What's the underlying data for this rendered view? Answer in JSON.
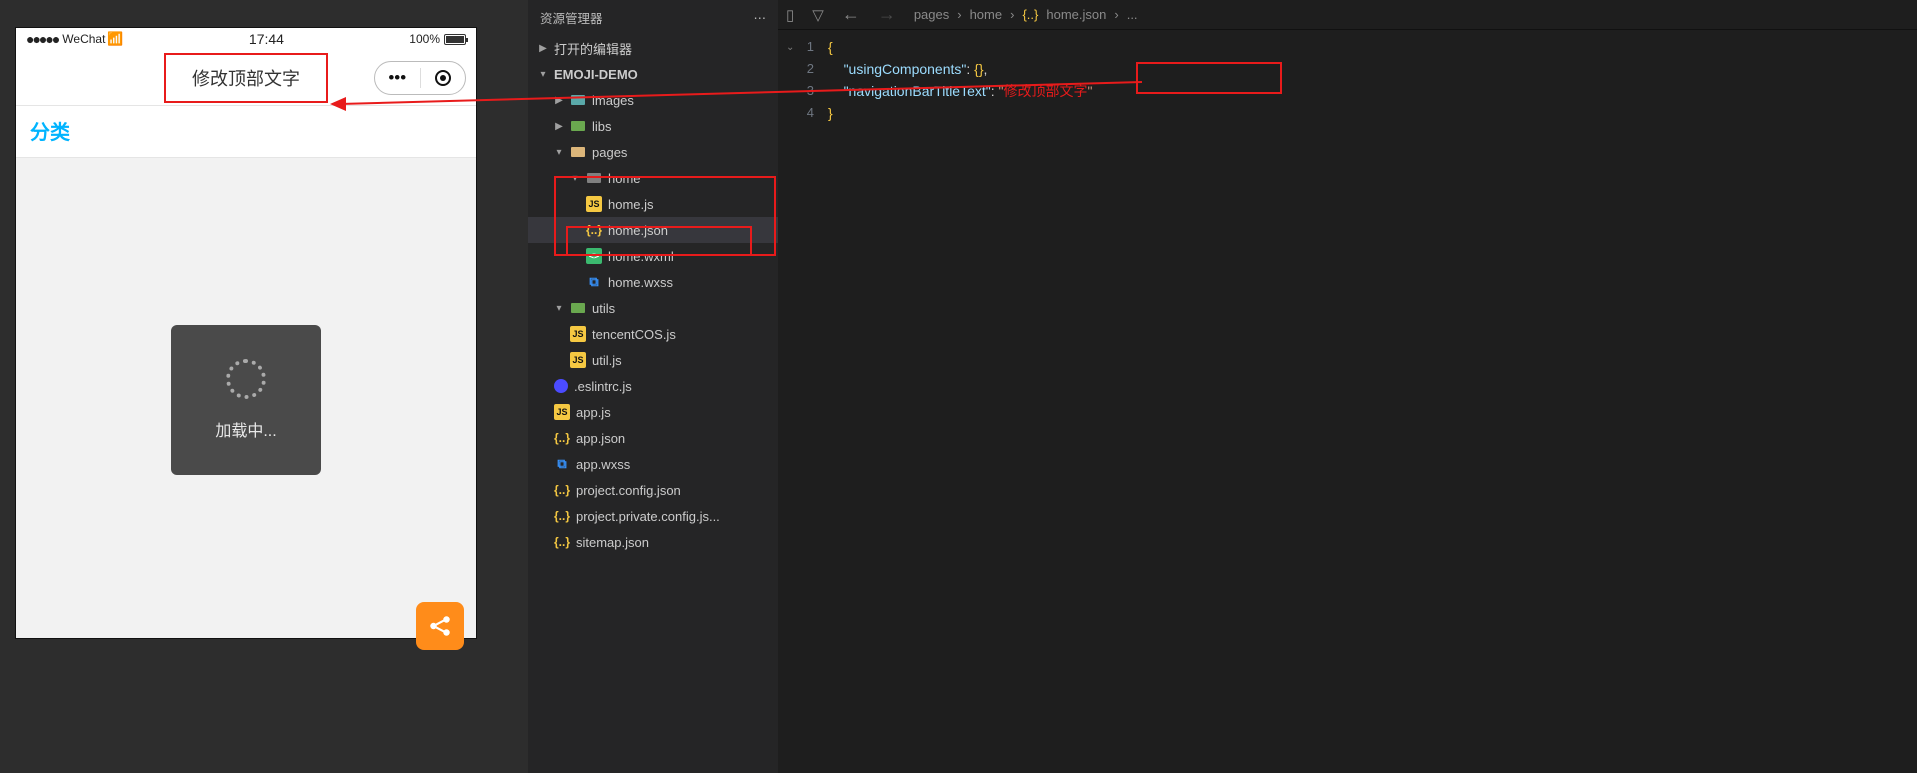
{
  "simulator": {
    "carrier": "WeChat",
    "time": "17:44",
    "battery": "100%",
    "title": "修改顶部文字",
    "tab_label": "分类",
    "loading": "加载中..."
  },
  "explorer": {
    "title": "资源管理器",
    "sections": {
      "open_editors": "打开的编辑器",
      "project": "EMOJI-DEMO"
    },
    "tree": {
      "images": "images",
      "libs": "libs",
      "pages": "pages",
      "home": "home",
      "home_js": "home.js",
      "home_json": "home.json",
      "home_wxml": "home.wxml",
      "home_wxss": "home.wxss",
      "utils": "utils",
      "tencentcos": "tencentCOS.js",
      "util": "util.js",
      "eslint": ".eslintrc.js",
      "appjs": "app.js",
      "appjson": "app.json",
      "appwxss": "app.wxss",
      "projconfig": "project.config.json",
      "projprivate": "project.private.config.js...",
      "sitemap": "sitemap.json"
    }
  },
  "editor": {
    "breadcrumb": {
      "p1": "pages",
      "p2": "home",
      "p3": "home.json",
      "more": "..."
    },
    "lines": {
      "l1": "1",
      "l2": "2",
      "l3": "3",
      "l4": "4"
    },
    "code": {
      "key1": "usingComponents",
      "val1": "{}",
      "key2": "navigationBarTitleText",
      "val2": "修改顶部文字"
    }
  }
}
